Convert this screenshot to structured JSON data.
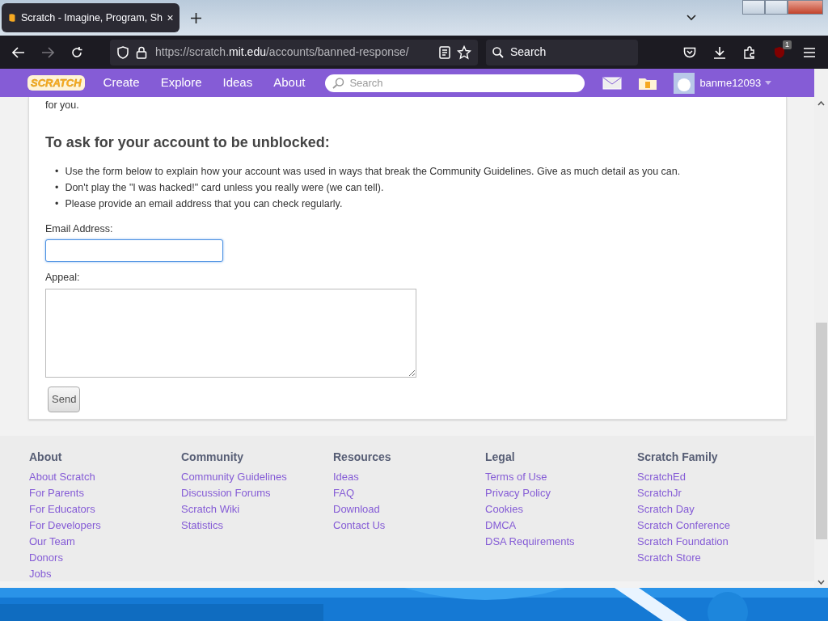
{
  "browser": {
    "tab": {
      "title": "Scratch - Imagine, Program, Sh",
      "selected": true
    },
    "url": {
      "scheme": "https://scratch.",
      "domain": "mit.edu",
      "path": "/accounts/banned-response/"
    },
    "search": {
      "placeholder": "Search"
    },
    "extension_badge": "1"
  },
  "site_nav": {
    "logo": "SCRATCH",
    "items": [
      "Create",
      "Explore",
      "Ideas",
      "About"
    ],
    "search": {
      "placeholder": "Search"
    },
    "username": "banme12093"
  },
  "content": {
    "intro": "for you.",
    "bullet_marker": "•",
    "heading": "To ask for your account to be unblocked:",
    "bullets": [
      "Use the form below to explain how your account was used in ways that break the Community Guidelines. Give as much detail as you can.",
      "Don't play the \"I was hacked!\" card unless you really were (we can tell).",
      "Please provide an email address that you can check regularly."
    ],
    "email_label": "Email Address:",
    "appeal_label": "Appeal:",
    "send_button": "Send"
  },
  "footer": [
    {
      "title": "About",
      "links": [
        "About Scratch",
        "For Parents",
        "For Educators",
        "For Developers",
        "Our Team",
        "Donors",
        "Jobs"
      ]
    },
    {
      "title": "Community",
      "links": [
        "Community Guidelines",
        "Discussion Forums",
        "Scratch Wiki",
        "Statistics"
      ]
    },
    {
      "title": "Resources",
      "links": [
        "Ideas",
        "FAQ",
        "Download",
        "Contact Us"
      ]
    },
    {
      "title": "Legal",
      "links": [
        "Terms of Use",
        "Privacy Policy",
        "Cookies",
        "DMCA",
        "DSA Requirements"
      ]
    },
    {
      "title": "Scratch Family",
      "links": [
        "ScratchEd",
        "ScratchJr",
        "Scratch Day",
        "Scratch Conference",
        "Scratch Foundation",
        "Scratch Store"
      ]
    }
  ]
}
